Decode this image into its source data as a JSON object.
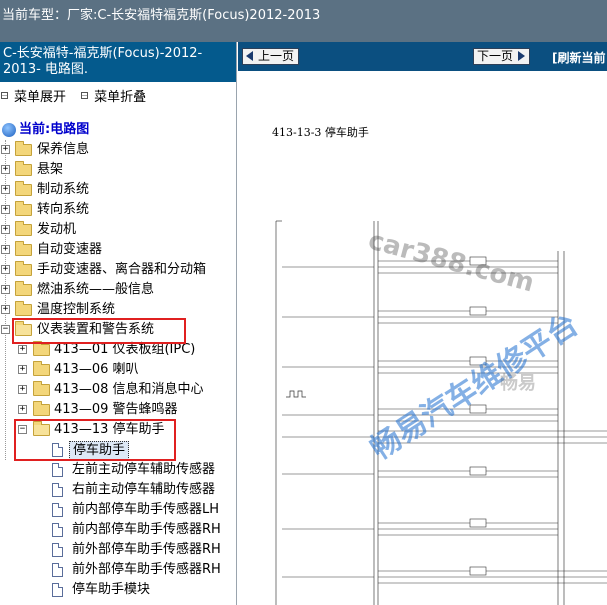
{
  "header": {
    "car_model_label": "当前车型：",
    "car_model_value": "厂家:C-长安福特福克斯(Focus)2012-2013"
  },
  "sidebar": {
    "title": "C-长安福特-福克斯(Focus)-2012-2013- 电路图.",
    "expand_all": "菜单展开",
    "collapse_all": "菜单折叠",
    "root": "当前:电路图",
    "items": [
      "保养信息",
      "悬架",
      "制动系统",
      "转向系统",
      "发动机",
      "自动变速器",
      "手动变速器、离合器和分动箱",
      "燃油系统——般信息",
      "温度控制系统",
      "仪表装置和警告系统"
    ],
    "subitems": [
      "413—01 仪表板组(IPC)",
      "413—06 喇叭",
      "413—08 信息和消息中心",
      "413—09 警告蜂鸣器",
      "413—13 停车助手"
    ],
    "docs": [
      "停车助手",
      "左前主动停车辅助传感器",
      "右前主动停车辅助传感器",
      "前内部停车助手传感器LH",
      "前内部停车助手传感器RH",
      "前外部停车助手传感器RH",
      "前外部停车助手传感器RH",
      "停车助手模块"
    ]
  },
  "toolbar": {
    "prev_page": "上一页",
    "next_page": "下一页",
    "refresh": "[刷新当前"
  },
  "diagram": {
    "title": "413-13-3 停车助手"
  },
  "watermarks": {
    "site": "car388.com",
    "brand": "畅易汽车维修平台",
    "small": "畅易"
  },
  "colors": {
    "topbar": "#5b7183",
    "panel_title": "#045a8d",
    "navbar": "#0b4f80",
    "highlight_box": "#e02020",
    "watermark": "#1f6fd0"
  }
}
